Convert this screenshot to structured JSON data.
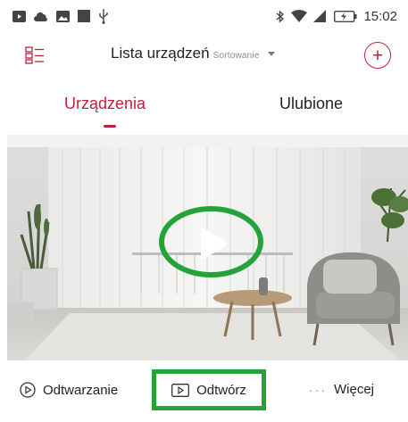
{
  "status_bar": {
    "time": "15:02",
    "icons": [
      "video-icon",
      "cloud-icon",
      "image-icon",
      "square-icon",
      "usb-icon",
      "bluetooth-icon",
      "wifi-icon",
      "signal-icon",
      "battery-icon"
    ]
  },
  "header": {
    "title": "Lista urządzeń",
    "sort_label": "Sortowanie",
    "add_label": "+"
  },
  "tabs": [
    {
      "label": "Urządzenia",
      "active": true
    },
    {
      "label": "Ulubione",
      "active": false
    }
  ],
  "video": {
    "play_icon": "play-icon"
  },
  "actions": {
    "playback_label": "Odtwarzanie",
    "open_label": "Odtwórz",
    "more_label": "Więcej",
    "more_dots": "···"
  },
  "colors": {
    "accent": "#c0203b",
    "highlight": "#23a33a"
  }
}
